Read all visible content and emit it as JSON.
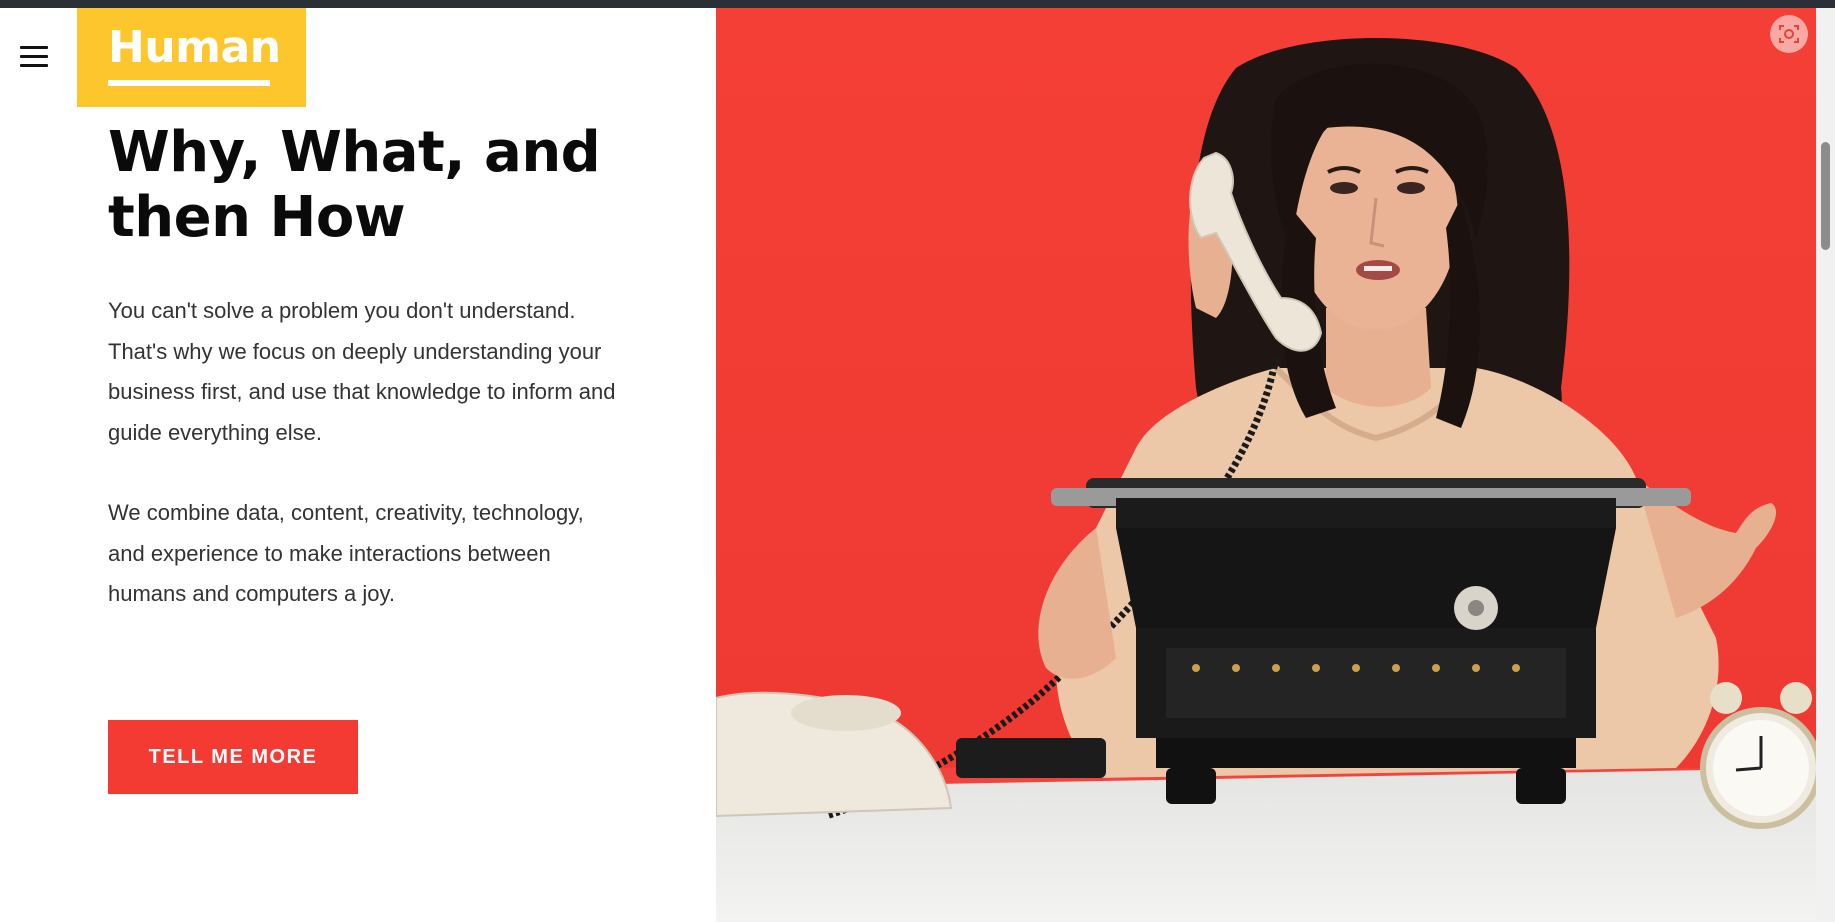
{
  "header": {
    "menu_icon": "hamburger-menu-icon",
    "logo_text": "Human"
  },
  "hero": {
    "headline": "Why, What, and then How",
    "paragraphs": [
      "You can't solve a problem you don't understand. That's why we focus on deeply understanding your business first, and use that knowledge to inform and guide everything else.",
      "We combine data, content, creativity, technology, and experience to make interactions between humans and computers a joy."
    ],
    "cta_label": "TELL ME MORE"
  },
  "image": {
    "subject": "woman-on-rotary-phone-at-typewriter-photo",
    "background_color": "#f4403a"
  },
  "browser": {
    "screenshot_icon": "screenshot-capture-icon"
  },
  "colors": {
    "brand_yellow": "#fec62d",
    "accent_red": "#f43b33",
    "text_dark": "#0a0a0a",
    "text_body": "#333333"
  }
}
